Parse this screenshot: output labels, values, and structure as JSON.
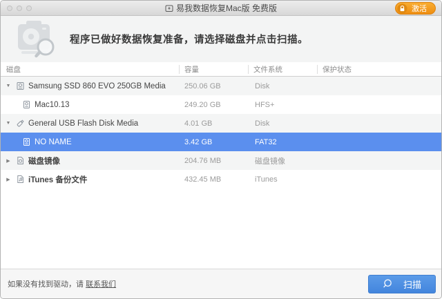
{
  "window": {
    "title": "易我数据恢复Mac版 免费版",
    "activate_label": "激活"
  },
  "header": {
    "message": "程序已做好数据恢复准备，请选择磁盘并点击扫描。",
    "icon": "drive-search-icon"
  },
  "table": {
    "columns": [
      "磁盘",
      "容量",
      "文件系统",
      "保护状态"
    ],
    "rows": [
      {
        "name": "Samsung SSD 860 EVO 250GB Media",
        "capacity": "250.06 GB",
        "filesystem": "Disk",
        "protection": "",
        "level": 0,
        "expanded": true,
        "selected": false,
        "bold": false,
        "icon": "internal-drive-icon"
      },
      {
        "name": "Mac10.13",
        "capacity": "249.20 GB",
        "filesystem": "HFS+",
        "protection": "",
        "level": 1,
        "expanded": null,
        "selected": false,
        "bold": false,
        "icon": "volume-icon"
      },
      {
        "name": "General USB Flash Disk Media",
        "capacity": "4.01 GB",
        "filesystem": "Disk",
        "protection": "",
        "level": 0,
        "expanded": true,
        "selected": false,
        "bold": false,
        "icon": "usb-drive-icon"
      },
      {
        "name": "NO NAME",
        "capacity": "3.42 GB",
        "filesystem": "FAT32",
        "protection": "",
        "level": 1,
        "expanded": null,
        "selected": true,
        "bold": false,
        "icon": "volume-icon"
      },
      {
        "name": "磁盘镜像",
        "capacity": "204.76 MB",
        "filesystem": "磁盘镜像",
        "protection": "",
        "level": 0,
        "expanded": false,
        "selected": false,
        "bold": true,
        "icon": "disk-image-icon"
      },
      {
        "name": "iTunes 备份文件",
        "capacity": "432.45 MB",
        "filesystem": "iTunes",
        "protection": "",
        "level": 0,
        "expanded": false,
        "selected": false,
        "bold": true,
        "icon": "itunes-backup-icon"
      }
    ]
  },
  "footer": {
    "hint_prefix": "如果没有找到驱动，请 ",
    "contact_link": "联系我们",
    "scan_label": "扫描"
  },
  "colors": {
    "selection": "#5b8fee",
    "accent_orange": "#f09a1d",
    "scan_blue": "#4385dd",
    "scan_blue_light": "#5b9be8"
  }
}
